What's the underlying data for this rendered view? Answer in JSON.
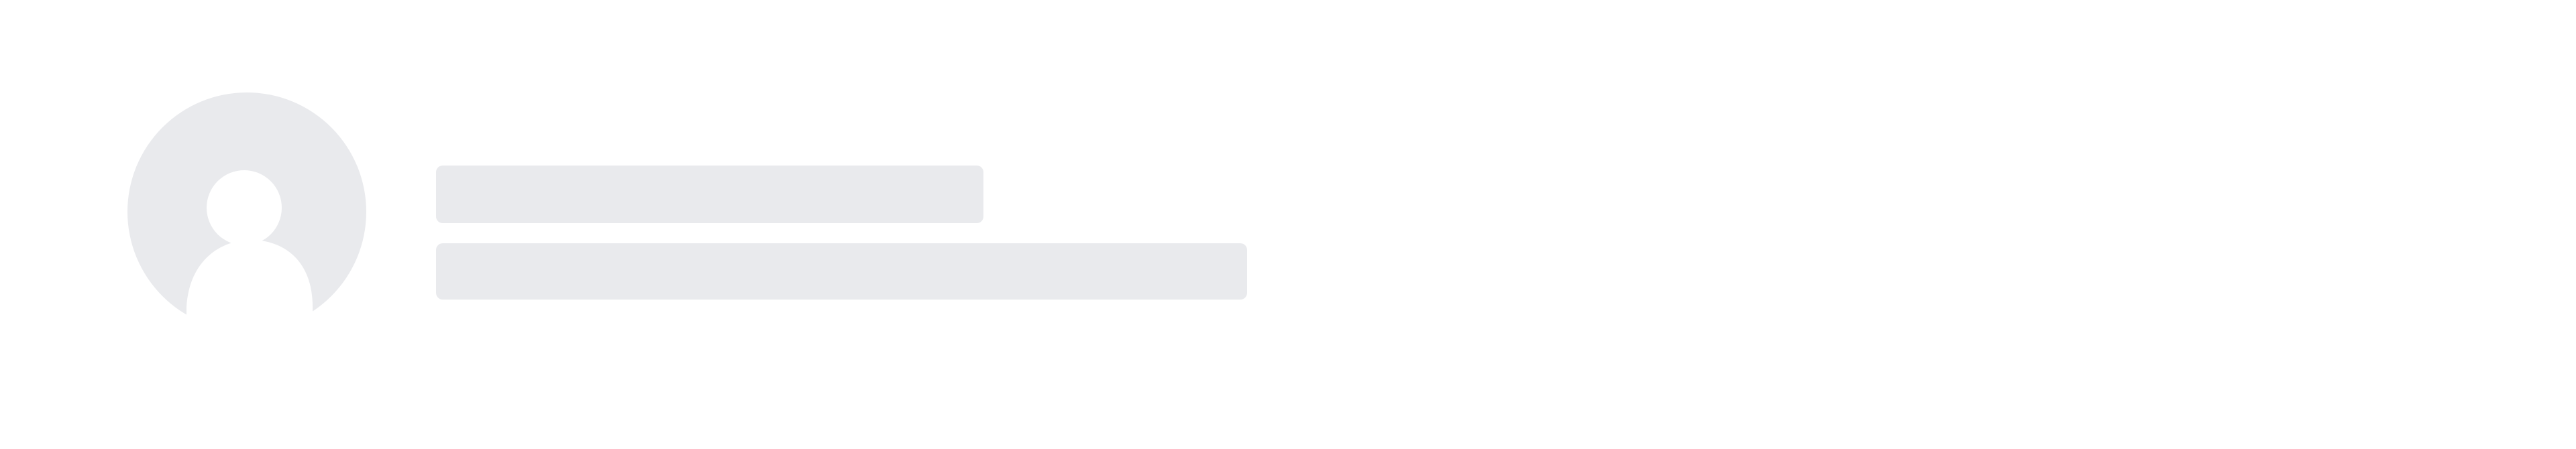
{
  "profile_skeleton": {
    "avatar_icon": "user-avatar-placeholder-icon",
    "skeleton_lines": [
      {
        "name": "name-placeholder-line",
        "text": ""
      },
      {
        "name": "description-placeholder-line",
        "text": ""
      }
    ]
  },
  "colors": {
    "background": "#ffffff",
    "skeleton": "#e9eaed",
    "avatar_figure": "#ffffff"
  }
}
